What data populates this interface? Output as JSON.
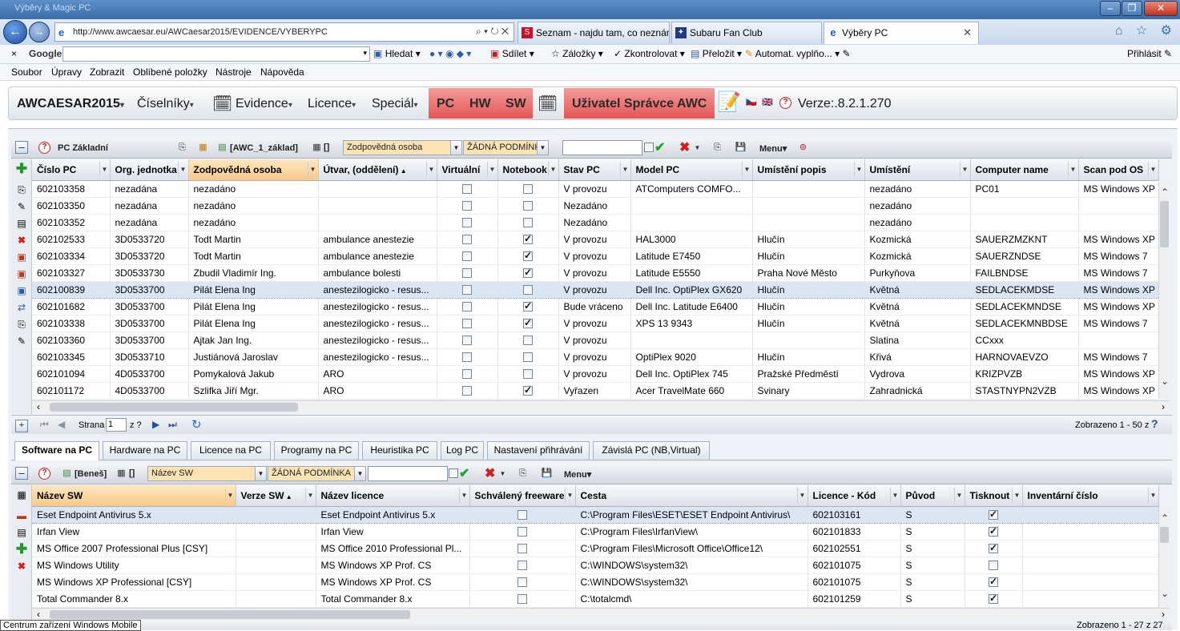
{
  "browser": {
    "title_text": "Výběry & Magic PC",
    "url": "http://www.awcaesar.eu/AWCaesar2015/EVIDENCE/VYBERYPC",
    "addr_tools": "⌕ ▾ ↻ ✕",
    "tabs": [
      {
        "label": "Seznam - najdu tam, co neznám",
        "fav": "S",
        "color": "#c8102e"
      },
      {
        "label": "Subaru Fan Club",
        "fav": "SF",
        "color": "#1f3b8a"
      },
      {
        "label": "Výběry PC",
        "fav": "e",
        "color": "#1a62c8",
        "active": true
      }
    ],
    "tab_close": "✕",
    "home": "⌂ ☆ ⚙"
  },
  "google_bar": {
    "close": "×",
    "brand": "Google",
    "search": "Hledat",
    "share": "Sdílet",
    "bookmarks": "Záložky",
    "check": "Zkontrolovat",
    "translate": "Přeložit",
    "autofill": "Automat. vyplňo...",
    "signin": "Přihlásit"
  },
  "menu": [
    "Soubor",
    "Úpravy",
    "Zobrazit",
    "Oblíbené položky",
    "Nástroje",
    "Nápověda"
  ],
  "app": {
    "brand": "AWCAESAR2015",
    "ciselniky": "Číselníky",
    "evidence": "Evidence",
    "licence": "Licence",
    "special": "Speciál",
    "pc": "PC",
    "hw": "HW",
    "sw": "SW",
    "user": "Uživatel Správce AWC",
    "version": "Verze:.8.2.1.270"
  },
  "top_panel": {
    "title": "PC Základní",
    "layout": "[AWC_1_základ]",
    "brackets": "[]",
    "field": "Zodpovědná osoba",
    "condition": "ŽÁDNÁ PODMÍNKA",
    "menu": "Menu",
    "columns": [
      "Číslo PC",
      "Org. jednotka",
      "Zodpovědná osoba",
      "Útvar, (oddělení)",
      "Virtuální",
      "Notebook",
      "Stav PC",
      "Model PC",
      "Umístění popis",
      "Umístění",
      "Computer name",
      "Scan pod OS"
    ],
    "rows": [
      [
        "602103358",
        "nezadána",
        "nezadáno",
        "",
        false,
        false,
        "V provozu",
        "ATComputers COMFO...",
        "",
        "nezadáno",
        "PC01",
        "MS Windows XP"
      ],
      [
        "602103350",
        "nezadána",
        "nezadáno",
        "",
        false,
        false,
        "Nezadáno",
        "",
        "",
        "nezadáno",
        "",
        ""
      ],
      [
        "602103352",
        "nezadána",
        "nezadáno",
        "",
        false,
        false,
        "Nezadáno",
        "",
        "",
        "nezadáno",
        "",
        ""
      ],
      [
        "602102533",
        "3D0533720",
        "Todt Martin",
        "ambulance anestezie",
        false,
        true,
        "V provozu",
        "HAL3000",
        "Hlučín",
        "Kozmická",
        "SAUERZMZKNT",
        "MS Windows XP"
      ],
      [
        "602103334",
        "3D0533720",
        "Todt Martin",
        "ambulance anestezie",
        false,
        true,
        "V provozu",
        "Latitude E7450",
        "Hlučín",
        "Kozmická",
        "SAUERZNDSE",
        "MS Windows 7"
      ],
      [
        "602103327",
        "3D0533730",
        "Zbudil Vladimír Ing.",
        "ambulance bolesti",
        false,
        true,
        "V provozu",
        "Latitude E5550",
        "Praha Nové Město",
        "Purkyňova",
        "FAILBNDSE",
        "MS Windows 7"
      ],
      [
        "602100839",
        "3D0533700",
        "Pilát Elena Ing",
        "anestezilogicko - resus...",
        false,
        false,
        "V provozu",
        "Dell Inc. OptiPlex GX620",
        "Hlučín",
        "Květná",
        "SEDLACEKMDSE",
        "MS Windows XP"
      ],
      [
        "602101682",
        "3D0533700",
        "Pilát Elena Ing",
        "anestezilogicko - resus...",
        false,
        true,
        "Bude vráceno",
        "Dell Inc. Latitude E6400",
        "Hlučín",
        "Květná",
        "SEDLACEKMNDSE",
        "MS Windows XP"
      ],
      [
        "602103338",
        "3D0533700",
        "Pilát Elena Ing",
        "anestezilogicko - resus...",
        false,
        true,
        "V provozu",
        "XPS 13 9343",
        "Hlučín",
        "Květná",
        "SEDLACEKMNBDSE",
        "MS Windows 7"
      ],
      [
        "602103360",
        "3D0533700",
        "Ajtak Jan Ing.",
        "anestezilogicko - resus...",
        false,
        false,
        "V provozu",
        "",
        "",
        "Slatina",
        "CCxxx",
        ""
      ],
      [
        "602103345",
        "3D0533710",
        "Justiánová Jaroslav",
        "anestezilogicko - resus...",
        false,
        false,
        "V provozu",
        "OptiPlex 9020",
        "Hlučín",
        "Křivá",
        "HARNOVAEVZO",
        "MS Windows 7"
      ],
      [
        "602101094",
        "4D0533700",
        "Pomykalová Jakub",
        "ARO",
        false,
        false,
        "V provozu",
        "Dell Inc. OptiPlex 745",
        "Pražské Předměstí",
        "Vydrova",
        "KRIZPVZB",
        "MS Windows XP"
      ],
      [
        "602101172",
        "4D0533700",
        "Szlifka Jiří Mgr.",
        "ARO",
        false,
        true,
        "Vyřazen",
        "Acer TravelMate 660",
        "Svinary",
        "Zahradnická",
        "STASTNYPN2VZB",
        "MS Windows XP"
      ]
    ],
    "pager": {
      "page_label": "Strana",
      "page": "1",
      "of": "z ?",
      "shown": "Zobrazeno 1 - 50 z"
    }
  },
  "tabs": [
    "Software na PC",
    "Hardware na PC",
    "Licence na PC",
    "Programy na PC",
    "Heuristika PC",
    "Log PC",
    "Nastavení přihrávání",
    "Závislá PC (NB,Virtual)"
  ],
  "bottom_panel": {
    "layout": "[Beneš]",
    "brackets": "[]",
    "field": "Název SW",
    "condition": "ŽÁDNÁ PODMÍNKA",
    "menu": "Menu",
    "columns": [
      "Název SW",
      "Verze SW",
      "Název licence",
      "Schválený freeware",
      "Cesta",
      "Licence - Kód",
      "Původ",
      "Tisknout",
      "Inventární číslo"
    ],
    "rows": [
      [
        "Eset Endpoint Antivirus 5.x",
        "",
        "Eset Endpoint Antivirus 5.x",
        false,
        "C:\\Program Files\\ESET\\ESET Endpoint Antivirus\\",
        "602103161",
        "S",
        true,
        ""
      ],
      [
        "Irfan View",
        "",
        "Irfan View",
        false,
        "C:\\Program Files\\IrfanView\\",
        "602101833",
        "S",
        true,
        ""
      ],
      [
        "MS Office 2007 Professional Plus [CSY]",
        "",
        "MS Office 2010 Professional Pl...",
        false,
        "C:\\Program Files\\Microsoft Office\\Office12\\",
        "602102551",
        "S",
        true,
        ""
      ],
      [
        "MS Windows Utility",
        "",
        "MS Windows XP Prof. CS",
        false,
        "C:\\WINDOWS\\system32\\",
        "602101075",
        "S",
        false,
        ""
      ],
      [
        "MS Windows XP Professional [CSY]",
        "",
        "MS Windows XP Prof. CS",
        false,
        "C:\\WINDOWS\\system32\\",
        "602101075",
        "S",
        true,
        ""
      ],
      [
        "Total Commander 8.x",
        "",
        "Total Commander 8.x",
        false,
        "C:\\totalcmd\\",
        "602101259",
        "S",
        true,
        ""
      ]
    ],
    "shown": "Zobrazeno 1 - 27 z 27"
  },
  "tooltip": "Centrum zařízení Windows Mobile"
}
